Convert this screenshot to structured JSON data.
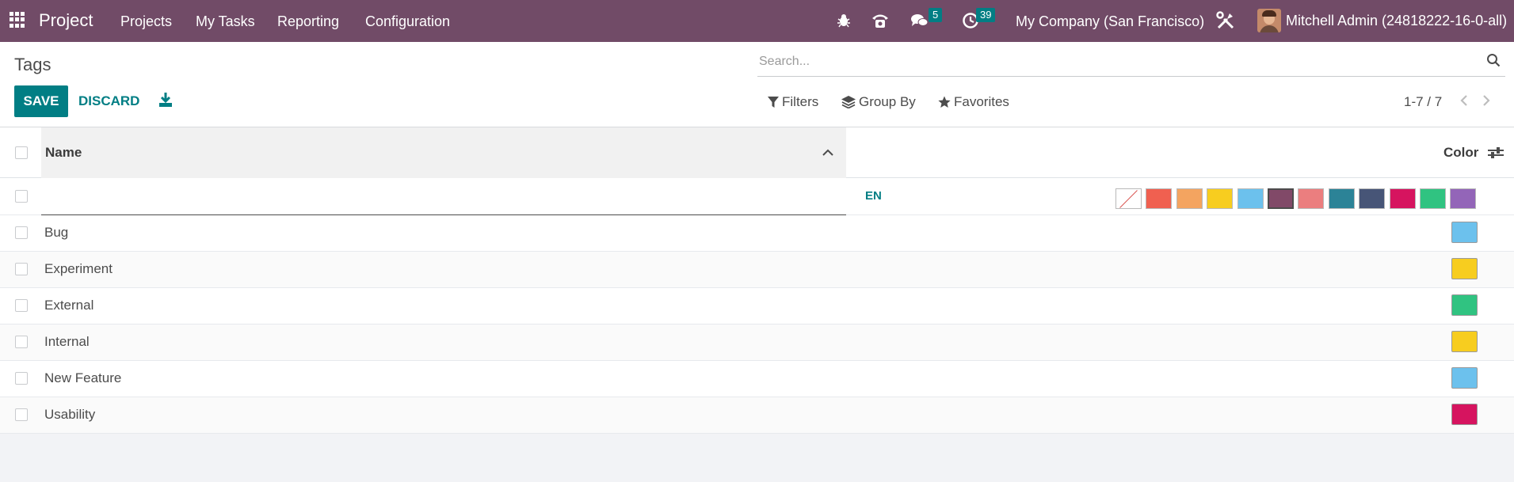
{
  "navbar": {
    "brand": "Project",
    "menu": [
      "Projects",
      "My Tasks",
      "Reporting",
      "Configuration"
    ],
    "messages_badge": "5",
    "activities_badge": "39",
    "company": "My Company (San Francisco)",
    "user": "Mitchell Admin (24818222-16-0-all)",
    "background_color": "#714b67"
  },
  "control_panel": {
    "title": "Tags",
    "save_label": "SAVE",
    "discard_label": "DISCARD",
    "search_placeholder": "Search...",
    "filters_label": "Filters",
    "groupby_label": "Group By",
    "favorites_label": "Favorites",
    "pager": "1-7 / 7"
  },
  "table": {
    "columns": {
      "name": "Name",
      "color": "Color"
    },
    "edit_row": {
      "value": "",
      "lang": "EN",
      "palette": [
        "none",
        "#f06050",
        "#f4a460",
        "#f7cd1f",
        "#6cc1ed",
        "#814968",
        "#eb7e7f",
        "#2c8397",
        "#475577",
        "#d6145f",
        "#30c381",
        "#9365b8"
      ],
      "selected_index": 5
    },
    "rows": [
      {
        "name": "Bug",
        "color": "#6cc1ed"
      },
      {
        "name": "Experiment",
        "color": "#f7cd1f"
      },
      {
        "name": "External",
        "color": "#30c381"
      },
      {
        "name": "Internal",
        "color": "#f7cd1f"
      },
      {
        "name": "New Feature",
        "color": "#6cc1ed"
      },
      {
        "name": "Usability",
        "color": "#d6145f"
      }
    ]
  },
  "accent_color": "#017e84"
}
